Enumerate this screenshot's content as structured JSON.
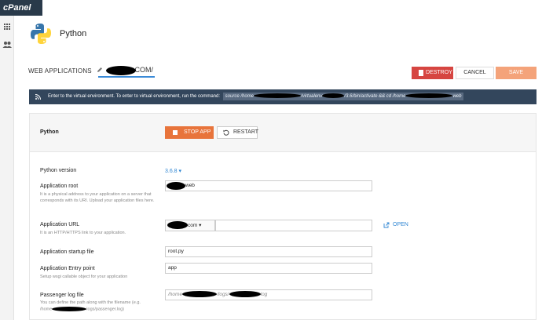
{
  "brand": {
    "logo_text": "cPanel"
  },
  "page": {
    "title": "Python"
  },
  "header": {
    "section_label": "WEB APPLICATIONS",
    "domain_suffix": "COM/"
  },
  "actions": {
    "destroy_label": "DESTROY",
    "cancel_label": "CANCEL",
    "save_label": "SAVE"
  },
  "banner": {
    "text": "Enter to the virtual environment. To enter to virtual environment, run the command:",
    "command_parts": [
      "source /home",
      "/virtualenv",
      "/3.6/bin/activate && cd /home",
      "web"
    ]
  },
  "app": {
    "name": "Python",
    "stop_label": "STOP APP",
    "restart_label": "RESTART"
  },
  "fields": {
    "python_version": {
      "label": "Python version",
      "value": "3.6.8"
    },
    "app_root": {
      "label": "Application root",
      "help": "It is a physical address to your application on a server that corresponds with its URI. Upload your application files here.",
      "value_suffix": "web"
    },
    "app_url": {
      "label": "Application URL",
      "help": "It is an HTTP/HTTPS link to your application.",
      "domain_suffix": "com",
      "open_label": "OPEN"
    },
    "startup_file": {
      "label": "Application startup file",
      "value": "root.py"
    },
    "entry_point": {
      "label": "Application Entry point",
      "help": "Setup wsgi callable object for your application",
      "value": "app"
    },
    "passenger_log": {
      "label": "Passenger log file",
      "help_prefix": "You can define the path along with the filename (e.g.",
      "help_path_start": "/home",
      "help_path_end": "logs/passenger.log)",
      "value_prefix": "/home",
      "value_mid": "/logs/",
      "value_suffix": "log"
    }
  },
  "colors": {
    "topbar": "#293a4a",
    "accent_blue": "#2f86d3",
    "destroy": "#d64541",
    "stop": "#e8743b",
    "save": "#f4a37a",
    "banner": "#33465c"
  },
  "icons": {
    "sidebar": [
      "grid-icon",
      "users-icon"
    ],
    "misc": [
      "python-logo-icon",
      "pencil-icon",
      "trash-icon",
      "rss-icon",
      "stop-icon",
      "restart-icon",
      "external-link-icon",
      "chevron-down-icon"
    ]
  }
}
